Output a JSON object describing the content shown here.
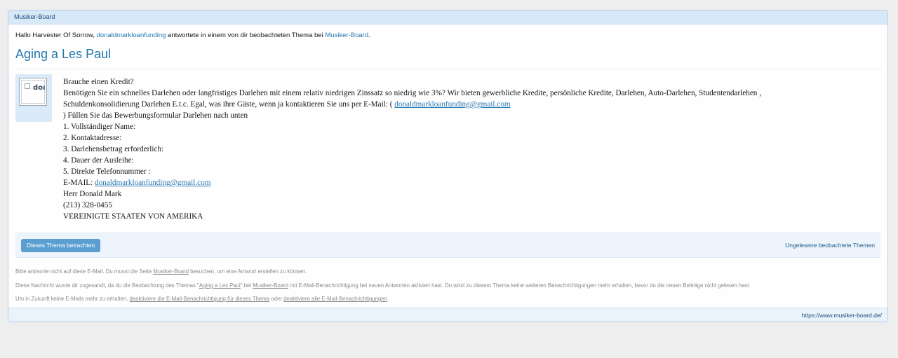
{
  "header": {
    "site_name": "Musiker-Board"
  },
  "intro": {
    "prefix": "Hallo Harvester Of Sorrow, ",
    "user": "donaldmarkloanfunding",
    "middle": " antwortete in einem von dir beobachteten Thema bei ",
    "site": "Musiker-Board",
    "suffix": "."
  },
  "thread": {
    "title": "Aging a Les Paul"
  },
  "avatar": {
    "alt_text": "doı"
  },
  "message": {
    "l1": "Brauche einen Kredit?",
    "l2": "Benötigen Sie ein schnelles Darlehen oder langfristiges Darlehen mit einem relativ niedrigen Zinssatz so niedrig wie 3%? Wir bieten gewerbliche Kredite, persönliche Kredite, Darlehen, Auto-Darlehen, Studentendarlehen ,",
    "l3a": "Schuldenkonsolidierung Darlehen E.t.c. Egal, was ihre Gäste, wenn ja kontaktieren Sie uns per E-Mail: ( ",
    "email": "donaldmarkloanfunding@gmail.com",
    "l4": ") Füllen Sie das Bewerbungsformular Darlehen nach unten",
    "l5": "1. Vollständiger Name:",
    "l6": "2. Kontaktadresse:",
    "l7": "3. Darlehensbetrag erforderlich:",
    "l8": "4. Dauer der Ausleihe:",
    "l9": "5. Direkte Telefonnummer :",
    "l10a": "E-MAIL: ",
    "l11": "Herr Donald Mark",
    "l12": "(213) 328-0455",
    "l13": "VEREINIGTE STAATEN VON AMERIKA"
  },
  "actions": {
    "view_button": "Dieses Thema betrachten",
    "unread_link": "Ungelesene beobachtete Themen"
  },
  "footer": {
    "p1_a": "Bitte antworte nicht auf diese E-Mail. Du musst die Seite ",
    "p1_link": "Musiker-Board",
    "p1_b": " besuchen, um eine Antwort erstellen zu können.",
    "p2_a": "Diese Nachricht wurde dir zugesandt, da du die Beobachtung des Themas \"",
    "p2_link1": "Aging a Les Paul",
    "p2_b": "\" bei ",
    "p2_link2": "Musiker-Board",
    "p2_c": " mit E-Mail-Benachrichtigung bei neuen Antworten aktiviert hast. Du wirst zu diesem Thema keine weiteren Benachrichtigungen mehr erhalten, bevor du die neuen Beiträge nicht gelesen hast.",
    "p3_a": "Um in Zukunft keine E-Mails mehr zu erhalten, ",
    "p3_link1": "deaktiviere die E-Mail-Benachrichtigung für dieses Thema",
    "p3_b": " oder ",
    "p3_link2": "deaktiviere alle E-Mail-Benachrichtigungen",
    "p3_c": ".",
    "site_url": "https://www.musiker-board.de/"
  },
  "colors": {
    "accent": "#2577b1",
    "button": "#5b9fd1",
    "header_bg": "#d7e8f7"
  }
}
